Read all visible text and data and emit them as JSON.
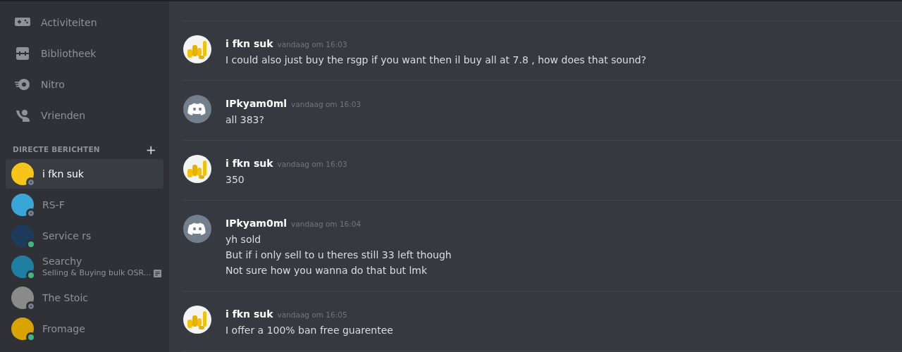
{
  "nav": [
    {
      "label": "Activiteiten"
    },
    {
      "label": "Bibliotheek"
    },
    {
      "label": "Nitro"
    },
    {
      "label": "Vrienden"
    }
  ],
  "dm_header": {
    "title": "DIRECTE BERICHTEN",
    "add": "+"
  },
  "direct_messages": [
    {
      "name": "i fkn suk",
      "selected": true,
      "online": false,
      "color": "#f5c518"
    },
    {
      "name": "RS-F",
      "selected": false,
      "online": false,
      "color": "#3aa6d8"
    },
    {
      "name": "Service rs",
      "selected": false,
      "online": true,
      "color": "#1d3b5a"
    },
    {
      "name": "Searchy",
      "selected": false,
      "online": true,
      "color": "#1f7fa3",
      "activity": "Selling & Buying bulk OSR..."
    },
    {
      "name": "The Stoic",
      "selected": false,
      "online": false,
      "color": "#8a8a8a"
    },
    {
      "name": "Fromage",
      "selected": false,
      "online": true,
      "color": "#d9a400"
    }
  ],
  "messages": [
    {
      "author": "i fkn suk",
      "time": "vandaag om 16:03",
      "kind": "coins",
      "lines": [
        "I could also just buy the rsgp if you want then il buy all at 7.8 , how does that sound?"
      ]
    },
    {
      "author": "IPkyam0ml",
      "time": "vandaag om 16:03",
      "kind": "default",
      "lines": [
        "all 383?"
      ]
    },
    {
      "author": "i fkn suk",
      "time": "vandaag om 16:03",
      "kind": "coins",
      "lines": [
        "350"
      ]
    },
    {
      "author": "IPkyam0ml",
      "time": "vandaag om 16:04",
      "kind": "default",
      "lines": [
        "yh sold",
        "But if i only sell to u theres still 33 left though",
        "Not sure how you wanna do that but lmk"
      ]
    },
    {
      "author": "i fkn suk",
      "time": "vandaag om 16:05",
      "kind": "coins",
      "lines": [
        "I offer a 100% ban free guarentee"
      ]
    }
  ]
}
